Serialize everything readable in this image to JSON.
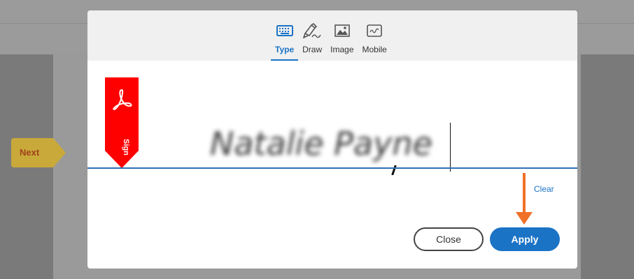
{
  "tabs": [
    {
      "label": "Type",
      "icon": "keyboard-icon",
      "active": true
    },
    {
      "label": "Draw",
      "icon": "pen-nib-icon",
      "active": false
    },
    {
      "label": "Image",
      "icon": "image-icon",
      "active": false
    },
    {
      "label": "Mobile",
      "icon": "mobile-signature-icon",
      "active": false
    }
  ],
  "background": {
    "next_label": "Next"
  },
  "ribbon": {
    "label": "Sign",
    "icon": "adobe-acrobat-icon"
  },
  "signature": {
    "value": "Natalie Payne"
  },
  "actions": {
    "clear_label": "Clear",
    "close_label": "Close",
    "apply_label": "Apply"
  },
  "colors": {
    "accent": "#1b73c6",
    "ribbon": "#ff0000",
    "arrow": "#f07028",
    "next_tab": "#c9a93a"
  }
}
